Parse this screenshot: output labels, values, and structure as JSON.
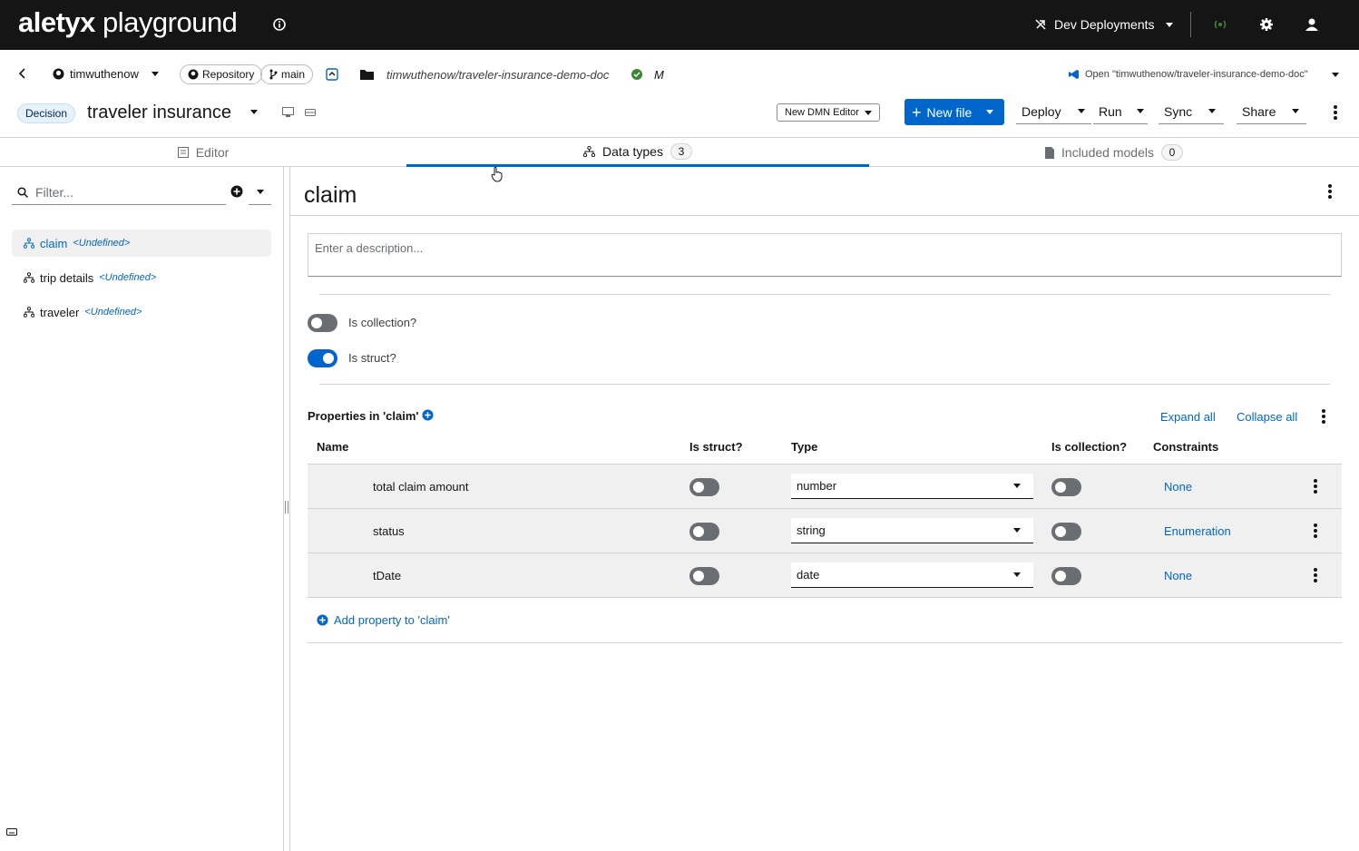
{
  "masthead": {
    "logo_brand": "aletyx",
    "logo_product": "playground",
    "deployments_label": "Dev Deployments"
  },
  "filebar": {
    "user": "timwuthenow",
    "repository_label": "Repository",
    "branch": "main",
    "repo_path": "timwuthenow/traveler-insurance-demo-doc",
    "modified_flag": "M",
    "open_in_label": "Open \"timwuthenow/traveler-insurance-demo-doc\"",
    "decision_badge": "Decision",
    "file_title": "traveler insurance",
    "editor_select": "New DMN Editor",
    "new_file": "New file",
    "deploy": "Deploy",
    "run": "Run",
    "sync": "Sync",
    "share": "Share"
  },
  "tabs": [
    {
      "label": "Editor",
      "count": ""
    },
    {
      "label": "Data types",
      "count": "3"
    },
    {
      "label": "Included models",
      "count": "0"
    }
  ],
  "sidebar": {
    "filter_placeholder": "Filter...",
    "items": [
      {
        "name": "claim",
        "type": "<Undefined>"
      },
      {
        "name": "trip details",
        "type": "<Undefined>"
      },
      {
        "name": "traveler",
        "type": "<Undefined>"
      }
    ]
  },
  "main": {
    "title": "claim",
    "description_placeholder": "Enter a description...",
    "is_collection_label": "Is collection?",
    "is_collection": false,
    "is_struct_label": "Is struct?",
    "is_struct": true,
    "properties_heading": "Properties in 'claim'",
    "expand_all": "Expand all",
    "collapse_all": "Collapse all",
    "columns": [
      "Name",
      "Is struct?",
      "Type",
      "Is collection?",
      "Constraints"
    ],
    "rows": [
      {
        "name": "total claim amount",
        "type": "number",
        "constraints": "None"
      },
      {
        "name": "status",
        "type": "string",
        "constraints": "Enumeration"
      },
      {
        "name": "tDate",
        "type": "date",
        "constraints": "None"
      }
    ],
    "add_property": "Add property to 'claim'"
  },
  "colors": {
    "masthead_bg": "#151515",
    "primary": "#0066cc",
    "row_bg": "#f0f0f0"
  }
}
